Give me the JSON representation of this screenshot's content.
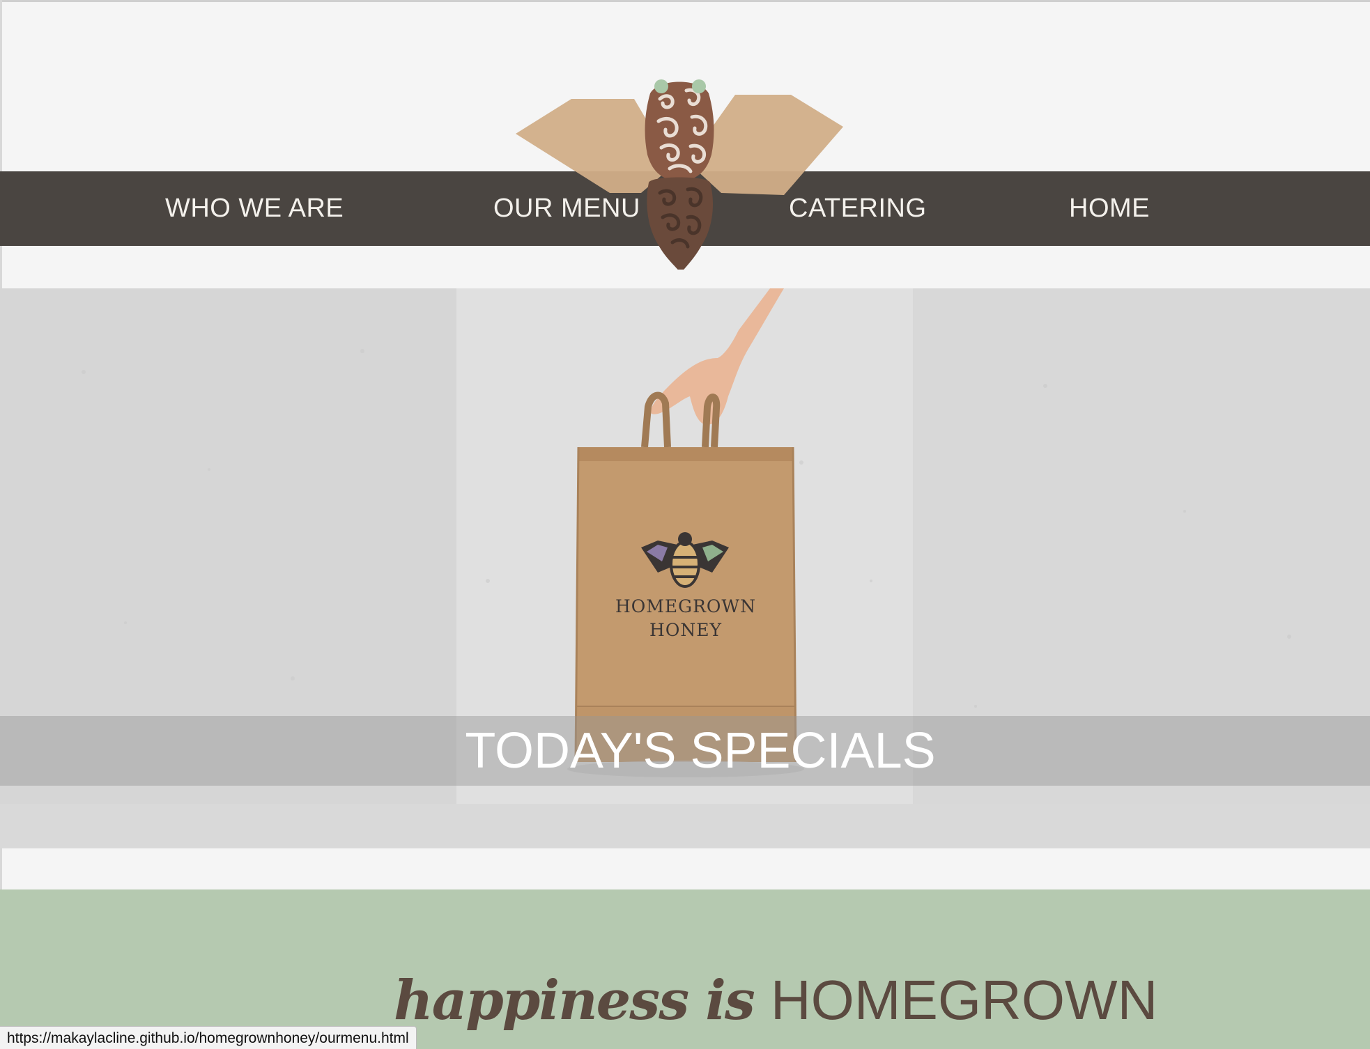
{
  "nav": {
    "items": [
      {
        "label": "WHO WE ARE"
      },
      {
        "label": "OUR MENU"
      },
      {
        "label": "CATERING"
      },
      {
        "label": "HOME"
      }
    ]
  },
  "hero": {
    "banner_text": "TODAY'S SPECIALS",
    "bag_brand_line1": "HOMEGROWN",
    "bag_brand_line2": "HONEY"
  },
  "tagline": {
    "script": "happiness is",
    "caps": "HOMEGROWN"
  },
  "status_bar": {
    "url": "https://makaylacline.github.io/homegrownhoney/ourmenu.html"
  },
  "colors": {
    "nav_bg": "#4a4541",
    "green_section": "#b5c9b0",
    "wing": "#d1ae88",
    "bee_body": "#8a5a45",
    "antenna": "#a9c8a8",
    "tagline_text": "#5b4a40"
  },
  "icons": {
    "logo": "bee-logo-icon",
    "bag_logo": "bee-bag-logo-icon"
  }
}
